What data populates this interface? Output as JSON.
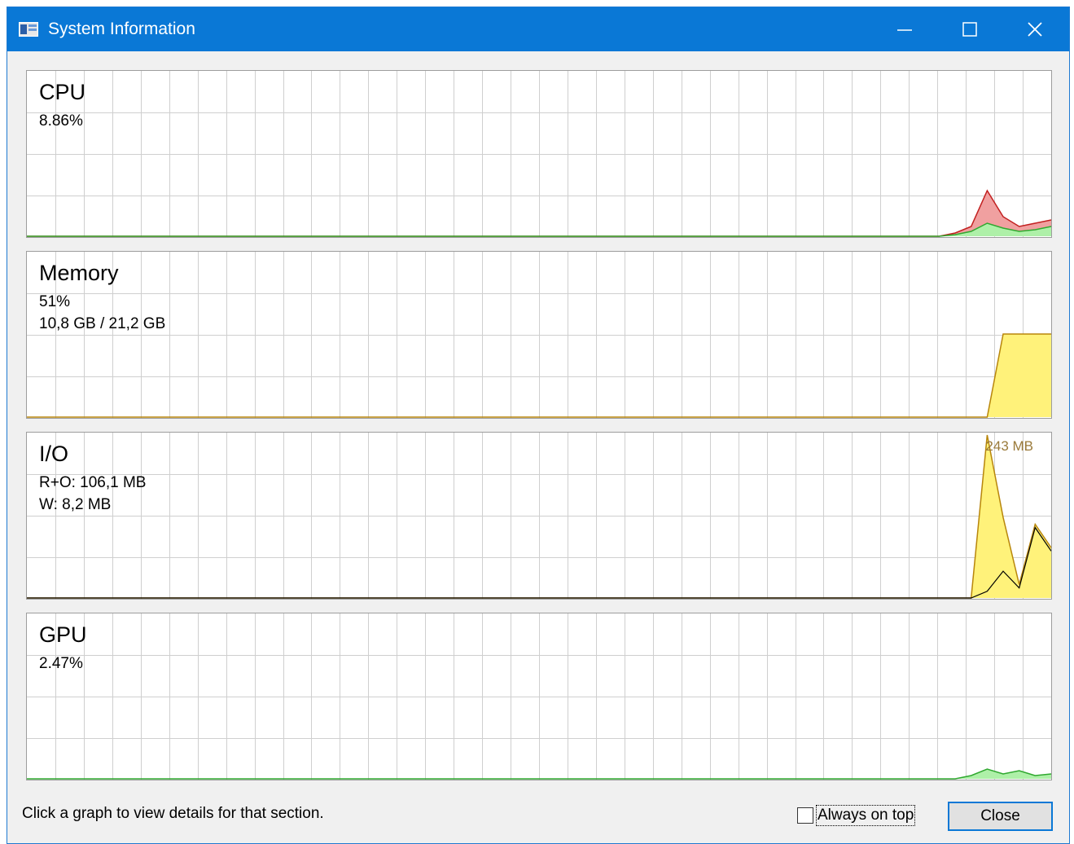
{
  "window": {
    "title": "System Information"
  },
  "titlebar_icons": {
    "app": "window-app-icon",
    "minimize": "minimize-icon",
    "maximize": "maximize-icon",
    "close": "close-icon"
  },
  "colors": {
    "titlebar": "#0a78d6",
    "grid": "#cfcfcf",
    "cpu_line": "#2fa82f",
    "cpu_fill": "#aef0a8",
    "cpu_kernel_line": "#c22020",
    "cpu_kernel_fill": "#f0a0a0",
    "memory_fill": "#fff27a",
    "memory_line": "#b8860b",
    "io_read_fill": "#fff27a",
    "io_write_line": "#000000",
    "gpu_line": "#2fa82f"
  },
  "panels": {
    "cpu": {
      "title": "CPU",
      "line1": "8.86%"
    },
    "memory": {
      "title": "Memory",
      "line1": "51%",
      "line2": "10,8 GB / 21,2 GB"
    },
    "io": {
      "title": "I/O",
      "line1": "R+O: 106,1 MB",
      "line2": "W: 8,2 MB",
      "peak_label": "243 MB"
    },
    "gpu": {
      "title": "GPU",
      "line1": "2.47%"
    }
  },
  "footer": {
    "status": "Click a graph to view details for that section.",
    "always_on_top_label": "Always on top",
    "always_on_top_checked": false,
    "close_label": "Close"
  },
  "chart_data": [
    {
      "type": "area",
      "name": "cpu",
      "description_hidden": false,
      "ylim": [
        0,
        100
      ],
      "series": [
        {
          "values": [
            0,
            0,
            0,
            0,
            0,
            0,
            0,
            0,
            0,
            0,
            0,
            0,
            0,
            0,
            0,
            0,
            0,
            0,
            0,
            0,
            0,
            0,
            0,
            0,
            0,
            0,
            0,
            0,
            0,
            0,
            0,
            0,
            0,
            0,
            0,
            0,
            0,
            0,
            0,
            0,
            0,
            0,
            0,
            0,
            0,
            0,
            0,
            0,
            0,
            0,
            0,
            0,
            0,
            0,
            0,
            0,
            0,
            0,
            2,
            6,
            28,
            12,
            6,
            8,
            10
          ]
        },
        {
          "values": [
            0,
            0,
            0,
            0,
            0,
            0,
            0,
            0,
            0,
            0,
            0,
            0,
            0,
            0,
            0,
            0,
            0,
            0,
            0,
            0,
            0,
            0,
            0,
            0,
            0,
            0,
            0,
            0,
            0,
            0,
            0,
            0,
            0,
            0,
            0,
            0,
            0,
            0,
            0,
            0,
            0,
            0,
            0,
            0,
            0,
            0,
            0,
            0,
            0,
            0,
            0,
            0,
            0,
            0,
            0,
            0,
            0,
            0,
            1,
            3,
            8,
            5,
            3,
            4,
            6
          ]
        }
      ]
    },
    {
      "type": "area",
      "name": "memory",
      "ylim": [
        0,
        100
      ],
      "series": [
        {
          "values": [
            0,
            0,
            0,
            0,
            0,
            0,
            0,
            0,
            0,
            0,
            0,
            0,
            0,
            0,
            0,
            0,
            0,
            0,
            0,
            0,
            0,
            0,
            0,
            0,
            0,
            0,
            0,
            0,
            0,
            0,
            0,
            0,
            0,
            0,
            0,
            0,
            0,
            0,
            0,
            0,
            0,
            0,
            0,
            0,
            0,
            0,
            0,
            0,
            0,
            0,
            0,
            0,
            0,
            0,
            0,
            0,
            0,
            0,
            0,
            0,
            0,
            51,
            51,
            51,
            51
          ]
        }
      ]
    },
    {
      "type": "area",
      "name": "io",
      "ylim": [
        0,
        243
      ],
      "series": [
        {
          "values": [
            0,
            0,
            0,
            0,
            0,
            0,
            0,
            0,
            0,
            0,
            0,
            0,
            0,
            0,
            0,
            0,
            0,
            0,
            0,
            0,
            0,
            0,
            0,
            0,
            0,
            0,
            0,
            0,
            0,
            0,
            0,
            0,
            0,
            0,
            0,
            0,
            0,
            0,
            0,
            0,
            0,
            0,
            0,
            0,
            0,
            0,
            0,
            0,
            0,
            0,
            0,
            0,
            0,
            0,
            0,
            0,
            0,
            0,
            0,
            0,
            243,
            120,
            20,
            110,
            75
          ]
        },
        {
          "values": [
            0,
            0,
            0,
            0,
            0,
            0,
            0,
            0,
            0,
            0,
            0,
            0,
            0,
            0,
            0,
            0,
            0,
            0,
            0,
            0,
            0,
            0,
            0,
            0,
            0,
            0,
            0,
            0,
            0,
            0,
            0,
            0,
            0,
            0,
            0,
            0,
            0,
            0,
            0,
            0,
            0,
            0,
            0,
            0,
            0,
            0,
            0,
            0,
            0,
            0,
            0,
            0,
            0,
            0,
            0,
            0,
            0,
            0,
            0,
            0,
            10,
            40,
            15,
            105,
            70
          ]
        }
      ]
    },
    {
      "type": "area",
      "name": "gpu",
      "ylim": [
        0,
        100
      ],
      "series": [
        {
          "values": [
            0,
            0,
            0,
            0,
            0,
            0,
            0,
            0,
            0,
            0,
            0,
            0,
            0,
            0,
            0,
            0,
            0,
            0,
            0,
            0,
            0,
            0,
            0,
            0,
            0,
            0,
            0,
            0,
            0,
            0,
            0,
            0,
            0,
            0,
            0,
            0,
            0,
            0,
            0,
            0,
            0,
            0,
            0,
            0,
            0,
            0,
            0,
            0,
            0,
            0,
            0,
            0,
            0,
            0,
            0,
            0,
            0,
            0,
            0,
            2,
            6,
            3,
            5,
            2,
            3
          ]
        }
      ]
    }
  ]
}
